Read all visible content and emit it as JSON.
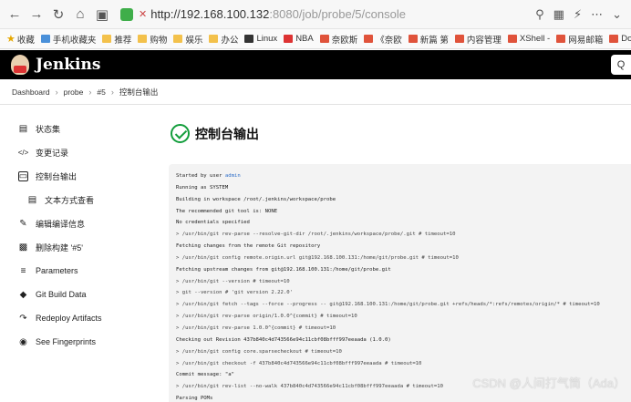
{
  "browser": {
    "url_host": "http://192.168.100.132",
    "url_path": ":8080/job/probe/5/console"
  },
  "bookmarks": [
    {
      "label": "收藏",
      "icon": "star-icon"
    },
    {
      "label": "手机收藏夹",
      "icon": "phone-icon"
    },
    {
      "label": "推荐",
      "icon": "folder-icon"
    },
    {
      "label": "购物",
      "icon": "folder-icon"
    },
    {
      "label": "娱乐",
      "icon": "folder-icon"
    },
    {
      "label": "办公",
      "icon": "folder-icon"
    },
    {
      "label": "Linux",
      "icon": "linux-icon"
    },
    {
      "label": "NBA",
      "icon": "nba-icon"
    },
    {
      "label": "奈欧斯",
      "icon": "site-icon"
    },
    {
      "label": "《奈欧",
      "icon": "site-icon"
    },
    {
      "label": "新篇 第",
      "icon": "site-icon"
    },
    {
      "label": "内容管理",
      "icon": "site-icon"
    },
    {
      "label": "XShell -",
      "icon": "site-icon"
    },
    {
      "label": "网易邮箱",
      "icon": "site-icon"
    },
    {
      "label": "Dock",
      "icon": "site-icon"
    }
  ],
  "header": {
    "title": "Jenkins"
  },
  "breadcrumb": [
    "Dashboard",
    "probe",
    "#5",
    "控制台输出"
  ],
  "sidebar": {
    "items": [
      {
        "label": "状态集",
        "icon": "document-icon",
        "sub": false,
        "active": false
      },
      {
        "label": "变更记录",
        "icon": "code-icon",
        "sub": false,
        "active": false
      },
      {
        "label": "控制台输出",
        "icon": "terminal-icon",
        "sub": false,
        "active": true
      },
      {
        "label": "文本方式查看",
        "icon": "file-icon",
        "sub": true,
        "active": false
      },
      {
        "label": "编辑编译信息",
        "icon": "edit-icon",
        "sub": false,
        "active": false
      },
      {
        "label": "删除构建 '#5'",
        "icon": "trash-icon",
        "sub": false,
        "active": false
      },
      {
        "label": "Parameters",
        "icon": "sliders-icon",
        "sub": false,
        "active": false
      },
      {
        "label": "Git Build Data",
        "icon": "git-icon",
        "sub": false,
        "active": false
      },
      {
        "label": "Redeploy Artifacts",
        "icon": "redeploy-icon",
        "sub": false,
        "active": false
      },
      {
        "label": "See Fingerprints",
        "icon": "fingerprint-icon",
        "sub": false,
        "active": false
      }
    ]
  },
  "main": {
    "title": "控制台输出",
    "console_user_prefix": "Started by user ",
    "console_user": "admin",
    "console_lines": [
      "Running as SYSTEM",
      "Building in workspace /root/.jenkins/workspace/probe",
      "The recommended git tool is: NONE",
      "No credentials specified",
      " > /usr/bin/git rev-parse --resolve-git-dir /root/.jenkins/workspace/probe/.git # timeout=10",
      "Fetching changes from the remote Git repository",
      " > /usr/bin/git config remote.origin.url git@192.168.100.131:/home/git/probe.git # timeout=10",
      "Fetching upstream changes from git@192.168.100.131:/home/git/probe.git",
      " > /usr/bin/git --version # timeout=10",
      " > git --version # 'git version 2.22.0'",
      " > /usr/bin/git fetch --tags --force --progress -- git@192.168.100.131:/home/git/probe.git +refs/heads/*:refs/remotes/origin/* # timeout=10",
      " > /usr/bin/git rev-parse origin/1.0.0^{commit} # timeout=10",
      " > /usr/bin/git rev-parse 1.0.0^{commit} # timeout=10",
      "Checking out Revision 437b840c4d743566e94c11cbf08bfff997eeaada (1.0.0)",
      " > /usr/bin/git config core.sparsecheckout # timeout=10",
      " > /usr/bin/git checkout -f 437b840c4d743566e94c11cbf08bfff997eeaada # timeout=10",
      "Commit message: \"a\"",
      " > /usr/bin/git rev-list --no-walk 437b840c4d743566e94c11cbf08bfff997eeaada # timeout=10",
      "Parsing POMs"
    ]
  },
  "watermark": "CSDN @人间打气筒（Ada）"
}
